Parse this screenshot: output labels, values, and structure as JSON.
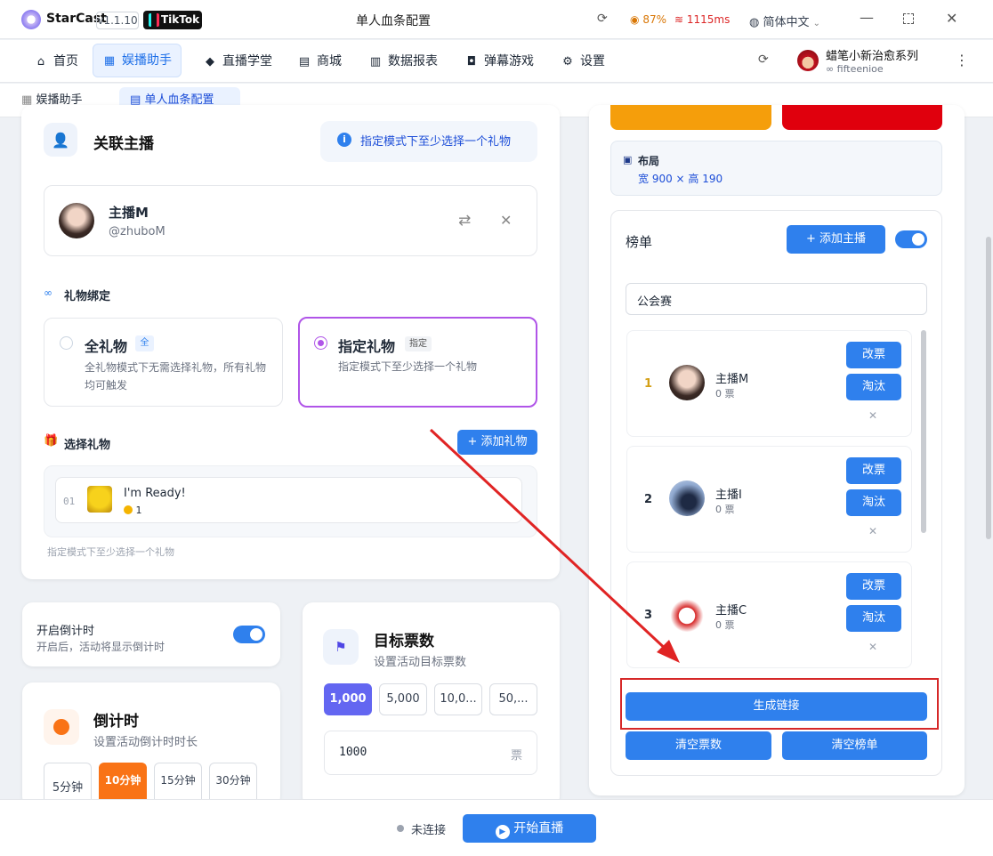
{
  "titlebar": {
    "app_name": "StarCast",
    "version": "v1.1.10",
    "platform": "TikTok",
    "window_title": "单人血条配置",
    "battery": "87%",
    "ping": "1115ms",
    "language": "简体中文"
  },
  "nav": {
    "items": [
      {
        "label": "首页",
        "icon": "home-icon"
      },
      {
        "label": "娱播助手",
        "icon": "grid-icon"
      },
      {
        "label": "直播学堂",
        "icon": "graduation-cap-icon"
      },
      {
        "label": "商城",
        "icon": "store-icon"
      },
      {
        "label": "数据报表",
        "icon": "chart-icon"
      },
      {
        "label": "弹幕游戏",
        "icon": "gamepad-icon"
      },
      {
        "label": "设置",
        "icon": "gear-icon"
      }
    ],
    "active": "娱播助手"
  },
  "user": {
    "name": "蜡笔小新治愈系列",
    "id": "fifteenioe"
  },
  "breadcrumbs": [
    {
      "label": "娱播助手"
    },
    {
      "label": "单人血条配置"
    }
  ],
  "link_anchor": {
    "title": "关联主播",
    "hint": "指定模式下至少选择一个礼物",
    "anchor_name": "主播M",
    "anchor_handle": "@zhuboM"
  },
  "gift_binding": {
    "title": "礼物绑定",
    "all": {
      "title": "全礼物",
      "badge": "全",
      "desc": "全礼物模式下无需选择礼物，所有礼物均可触发"
    },
    "specified": {
      "title": "指定礼物",
      "badge": "指定",
      "desc": "指定模式下至少选择一个礼物"
    }
  },
  "select_gift": {
    "title": "选择礼物",
    "add_label": "添加礼物",
    "gifts": [
      {
        "index": "01",
        "name": "I'm Ready!",
        "coins": "1"
      }
    ],
    "hint": "指定模式下至少选择一个礼物"
  },
  "countdown_toggle": {
    "title": "开启倒计时",
    "desc": "开启后，活动将显示倒计时"
  },
  "countdown": {
    "title": "倒计时",
    "desc": "设置活动倒计时时长",
    "options": [
      "5分钟",
      "10分钟",
      "15分钟",
      "30分钟"
    ],
    "selected": "10分钟"
  },
  "target": {
    "title": "目标票数",
    "desc": "设置活动目标票数",
    "options": [
      "1,000",
      "5,000",
      "10,0...",
      "50,..."
    ],
    "selected": "1,000",
    "value": "1000",
    "unit": "票"
  },
  "layout": {
    "label": "布局",
    "size": "宽 900 × 高 190"
  },
  "ranking": {
    "title": "榜单",
    "add_label": "添加主播",
    "name_value": "公会赛",
    "entries": [
      {
        "rank": "1",
        "name": "主播M",
        "votes": "0 票"
      },
      {
        "rank": "2",
        "name": "主播I",
        "votes": "0 票"
      },
      {
        "rank": "3",
        "name": "主播C",
        "votes": "0 票"
      }
    ],
    "edit_label": "改票",
    "eliminate_label": "淘汰",
    "generate_label": "生成链接",
    "clear_votes_label": "清空票数",
    "clear_list_label": "清空榜单"
  },
  "bottom": {
    "status": "未连接",
    "start_label": "开始直播"
  }
}
